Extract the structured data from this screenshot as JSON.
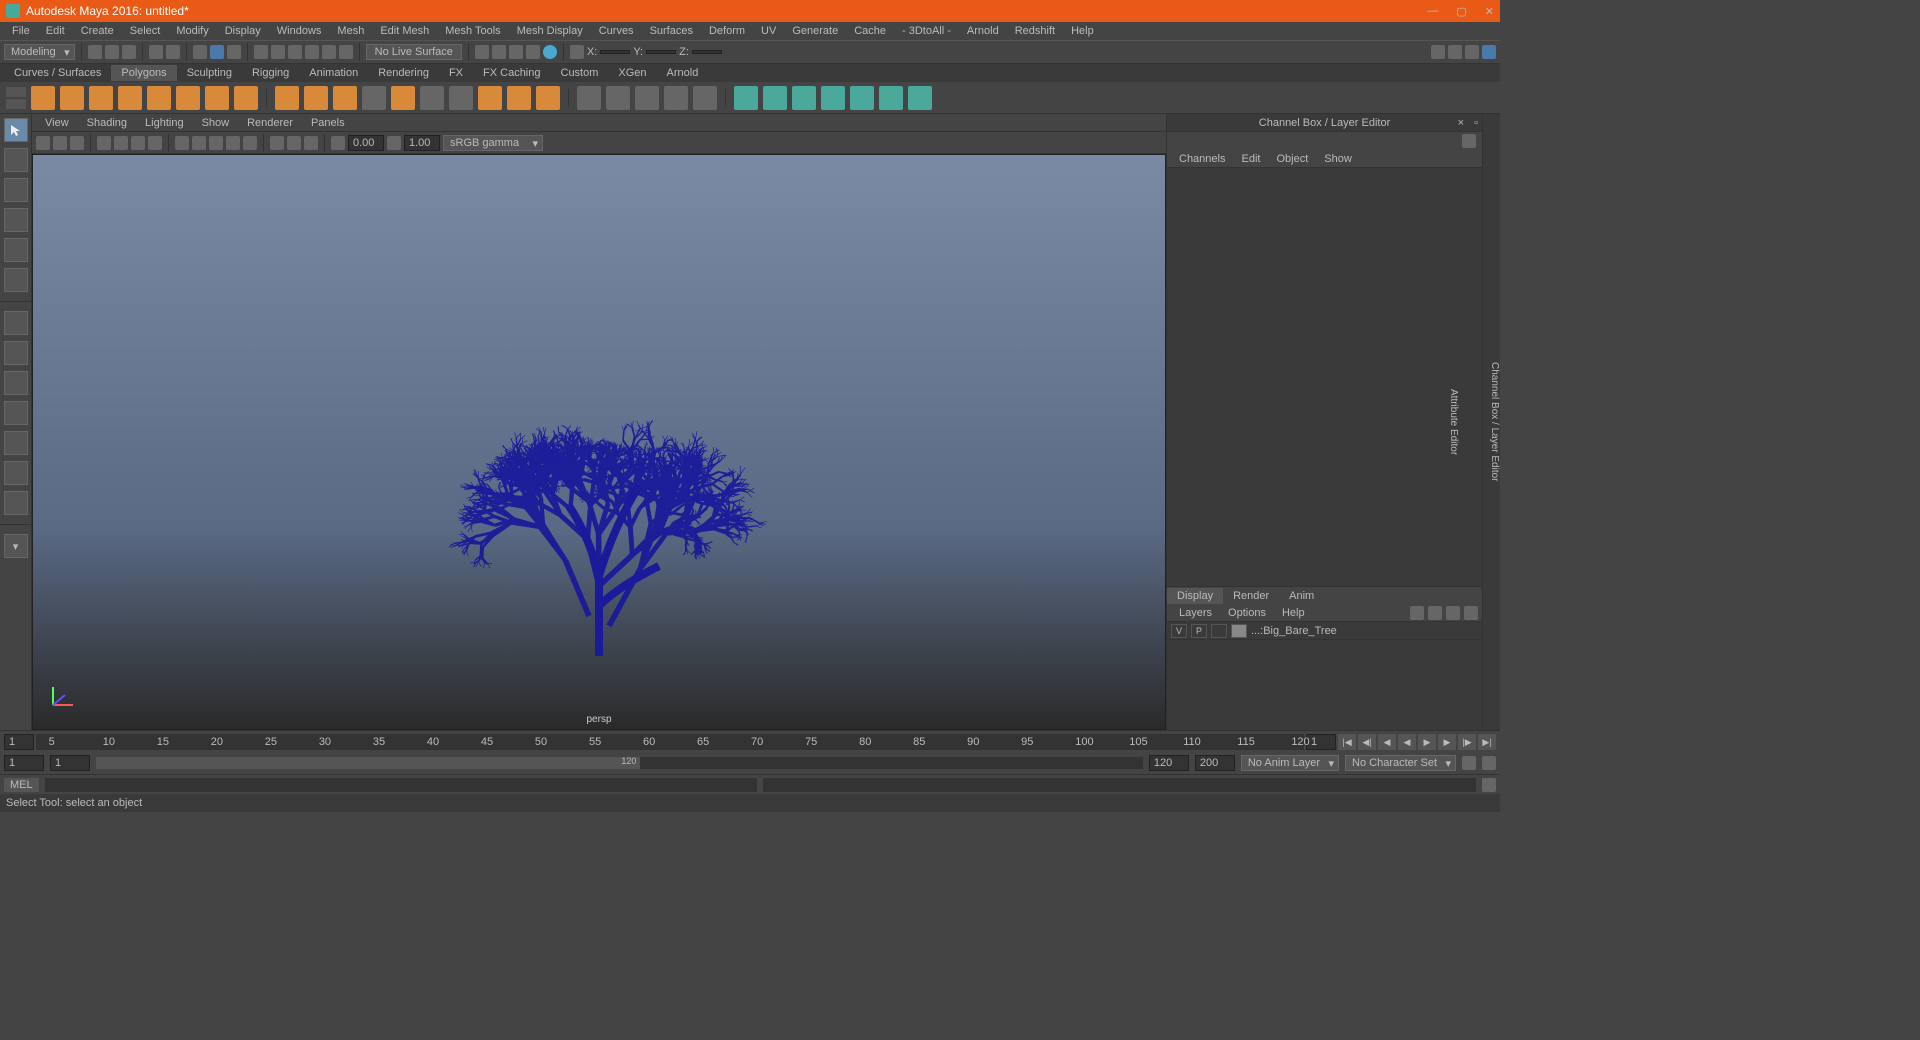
{
  "title": "Autodesk Maya 2016: untitled*",
  "menu": [
    "File",
    "Edit",
    "Create",
    "Select",
    "Modify",
    "Display",
    "Windows",
    "Mesh",
    "Edit Mesh",
    "Mesh Tools",
    "Mesh Display",
    "Curves",
    "Surfaces",
    "Deform",
    "UV",
    "Generate",
    "Cache",
    "- 3DtoAll -",
    "Arnold",
    "Redshift",
    "Help"
  ],
  "workspace": "Modeling",
  "live_surface": "No Live Surface",
  "coords": {
    "x": "X:",
    "y": "Y:",
    "z": "Z:"
  },
  "shelf_tabs": [
    "Curves / Surfaces",
    "Polygons",
    "Sculpting",
    "Rigging",
    "Animation",
    "Rendering",
    "FX",
    "FX Caching",
    "Custom",
    "XGen",
    "Arnold"
  ],
  "shelf_active": 1,
  "panel_menu": [
    "View",
    "Shading",
    "Lighting",
    "Show",
    "Renderer",
    "Panels"
  ],
  "exposure": "0.00",
  "gamma": "1.00",
  "color_space": "sRGB gamma",
  "camera": "persp",
  "channel_title": "Channel Box / Layer Editor",
  "channel_menu": [
    "Channels",
    "Edit",
    "Object",
    "Show"
  ],
  "layer_tabs": [
    "Display",
    "Render",
    "Anim"
  ],
  "layer_menu": [
    "Layers",
    "Options",
    "Help"
  ],
  "layer_row": {
    "v": "V",
    "p": "P",
    "name": "...:Big_Bare_Tree"
  },
  "right_tabs": [
    "Channel Box / Layer Editor",
    "Attribute Editor"
  ],
  "timeline": {
    "start": "1",
    "end": "120",
    "range_start": "1",
    "range_end": "120",
    "anim_end": "200",
    "anim_layer": "No Anim Layer",
    "char_set": "No Character Set"
  },
  "ticks": [
    5,
    10,
    15,
    20,
    25,
    30,
    35,
    40,
    45,
    50,
    55,
    60,
    65,
    70,
    75,
    80,
    85,
    90,
    95,
    100,
    105,
    110,
    115,
    120
  ],
  "cmd_lang": "MEL",
  "status_text": "Select Tool: select an object"
}
